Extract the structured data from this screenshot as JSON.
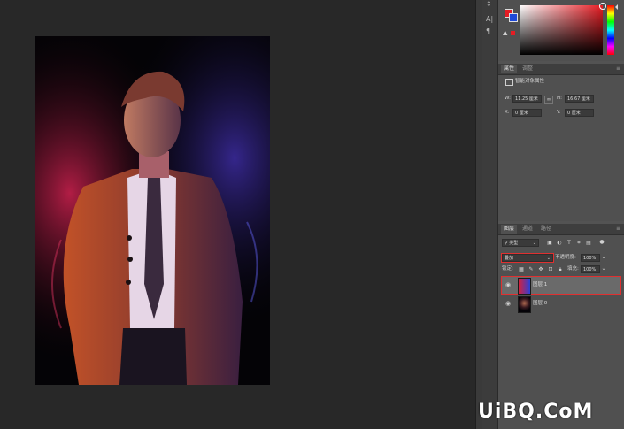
{
  "tools_column": {
    "glyphs": [
      "↕",
      "A|",
      "¶"
    ]
  },
  "color_panel": {
    "fg_color": "#e51c23",
    "bg_color": "#1e49d8"
  },
  "properties_panel": {
    "tabs": [
      "属性",
      "调整"
    ],
    "section_title": "智能对象属性",
    "w_label": "W:",
    "w_value": "11.25 厘米",
    "link_icon": "link-icon",
    "h_label": "H:",
    "h_value": "16.67 厘米",
    "x_label": "X:",
    "x_value": "0 厘米",
    "y_label": "Y:",
    "y_value": "0 厘米"
  },
  "layers_panel": {
    "tabs": [
      "图层",
      "通道",
      "路径"
    ],
    "filter_label": "类型",
    "blend_mode": "叠加",
    "opacity_label": "不透明度:",
    "opacity_value": "100%",
    "lock_label": "锁定:",
    "fill_label": "填充:",
    "fill_value": "100%",
    "layers": [
      {
        "name": "图层 1",
        "selected": true
      },
      {
        "name": "图层 0",
        "selected": false
      }
    ]
  },
  "highlight_color": "#e03030",
  "watermark": "UiBQ.CoM"
}
